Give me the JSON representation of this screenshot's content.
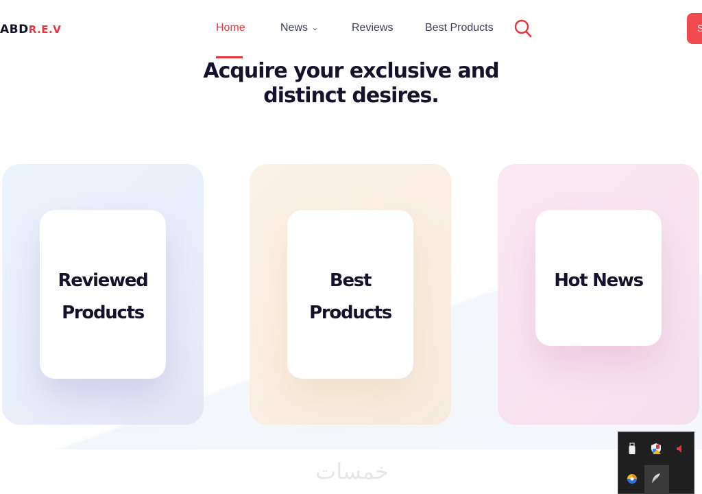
{
  "header": {
    "logo_part1": "ABD",
    "logo_part2": "R.E.V",
    "nav": [
      {
        "label": "Home",
        "active": true
      },
      {
        "label": "News",
        "has_dropdown": true
      },
      {
        "label": "Reviews"
      },
      {
        "label": "Best Products"
      }
    ],
    "cta_label": "S"
  },
  "hero": {
    "title": "Acquire your exclusive and distinct desires."
  },
  "cards": [
    {
      "title": "Reviewed Products"
    },
    {
      "title": "Best Products"
    },
    {
      "title": "Hot News"
    }
  ],
  "watermark": "خمسات",
  "tray": {
    "icons": [
      "usb-drive-icon",
      "security-shield-icon",
      "speaker-muted-icon",
      "color-picker-icon",
      "feather-pen-icon"
    ]
  },
  "colors": {
    "accent": "#e8343a",
    "text_dark": "#14132b",
    "nav_text": "#3a3d55",
    "card_blue": "#e9eef9",
    "card_peach": "#f9eee1",
    "card_pink": "#f8e3ef"
  }
}
